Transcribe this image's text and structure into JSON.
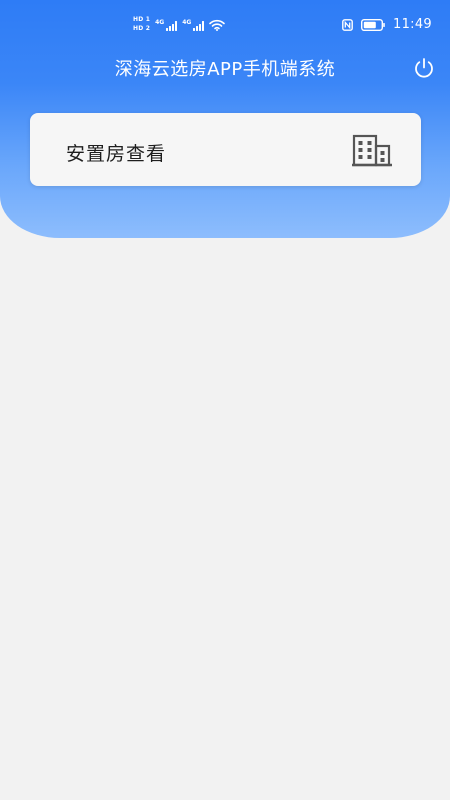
{
  "status_bar": {
    "hd1": "HD 1",
    "hd2": "HD 2",
    "net1": "4G",
    "net2": "4G",
    "time": "11:49"
  },
  "header": {
    "title": "深海云选房APP手机端系统",
    "power_icon": "power-icon"
  },
  "menu": {
    "items": [
      {
        "label": "安置房查看",
        "icon": "building-icon"
      }
    ]
  },
  "colors": {
    "header_top": "#2e7cf6",
    "header_bottom": "#8dbdfd",
    "background": "#f2f2f2",
    "card": "#f6f6f6",
    "icon": "#555555"
  }
}
